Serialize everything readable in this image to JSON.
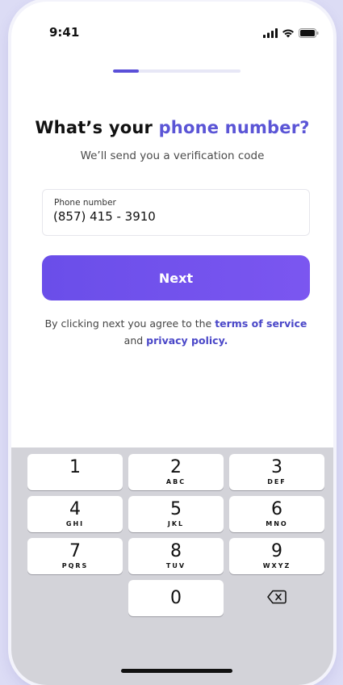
{
  "status_bar": {
    "time": "9:41",
    "icons": [
      "signal-icon",
      "wifi-icon",
      "battery-icon"
    ]
  },
  "progress": {
    "value": 0.2
  },
  "heading": {
    "prefix": "What’s your ",
    "accent": "phone number?"
  },
  "subtitle": "We’ll send you a verification code",
  "phone_field": {
    "label": "Phone number",
    "value": "(857) 415 - 3910"
  },
  "next_button": {
    "label": "Next"
  },
  "terms": {
    "text_1": "By clicking next you agree to the ",
    "link_terms": "terms of service",
    "text_2": "and ",
    "link_privacy": "privacy policy."
  },
  "keypad": {
    "keys": [
      {
        "num": "1",
        "letters": ""
      },
      {
        "num": "2",
        "letters": "ABC"
      },
      {
        "num": "3",
        "letters": "DEF"
      },
      {
        "num": "4",
        "letters": "GHI"
      },
      {
        "num": "5",
        "letters": "JKL"
      },
      {
        "num": "6",
        "letters": "MNO"
      },
      {
        "num": "7",
        "letters": "PQRS"
      },
      {
        "num": "8",
        "letters": "TUV"
      },
      {
        "num": "9",
        "letters": "WXYZ"
      },
      {
        "num": "0",
        "letters": ""
      }
    ],
    "delete_icon": "backspace-icon"
  },
  "colors": {
    "accent": "#5b55d6",
    "button": "#6a4ee9",
    "page_background": "#dcdcf5"
  }
}
